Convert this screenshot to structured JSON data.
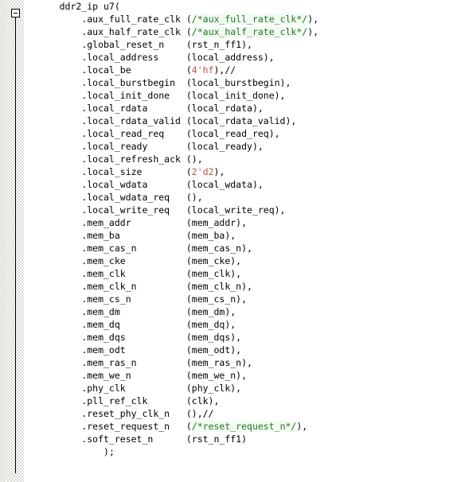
{
  "editor": {
    "gutter": {
      "fold_marker": "collapse-minus",
      "fold_state": "expanded"
    },
    "syntax_colors": {
      "default": "#000000",
      "comment": "#1a7a1a",
      "comment_background": "#f4faf4",
      "number_literal": "#c0504d",
      "background": "#ffffff",
      "gutter_background": "#e8e9e0"
    },
    "language": "verilog",
    "code_lines": [
      {
        "indent": 5,
        "tokens": [
          {
            "text": "ddr2_ip u7(",
            "type": "default"
          }
        ]
      },
      {
        "indent": 9,
        "tokens": [
          {
            "text": ".aux_full_rate_clk (",
            "type": "default"
          },
          {
            "text": "/*aux_full_rate_clk*/",
            "type": "comment"
          },
          {
            "text": "),",
            "type": "default"
          }
        ]
      },
      {
        "indent": 9,
        "tokens": [
          {
            "text": ".aux_half_rate_clk (",
            "type": "default"
          },
          {
            "text": "/*aux_half_rate_clk*/",
            "type": "comment"
          },
          {
            "text": "),",
            "type": "default"
          }
        ]
      },
      {
        "indent": 9,
        "tokens": [
          {
            "text": ".global_reset_n    (rst_n_ff1),",
            "type": "default"
          }
        ]
      },
      {
        "indent": 9,
        "tokens": [
          {
            "text": ".local_address     (local_address),",
            "type": "default"
          }
        ]
      },
      {
        "indent": 9,
        "tokens": [
          {
            "text": ".local_be          (",
            "type": "default"
          },
          {
            "text": "4'hf",
            "type": "number"
          },
          {
            "text": "),//",
            "type": "default"
          }
        ]
      },
      {
        "indent": 9,
        "tokens": [
          {
            "text": ".local_burstbegin  (local_burstbegin),",
            "type": "default"
          }
        ]
      },
      {
        "indent": 9,
        "tokens": [
          {
            "text": ".local_init_done   (local_init_done),",
            "type": "default"
          }
        ]
      },
      {
        "indent": 9,
        "tokens": [
          {
            "text": ".local_rdata       (local_rdata),",
            "type": "default"
          }
        ]
      },
      {
        "indent": 9,
        "tokens": [
          {
            "text": ".local_rdata_valid (local_rdata_valid),",
            "type": "default"
          }
        ]
      },
      {
        "indent": 9,
        "tokens": [
          {
            "text": ".local_read_req    (local_read_req),",
            "type": "default"
          }
        ]
      },
      {
        "indent": 9,
        "tokens": [
          {
            "text": ".local_ready       (local_ready),",
            "type": "default"
          }
        ]
      },
      {
        "indent": 9,
        "tokens": [
          {
            "text": ".local_refresh_ack (),",
            "type": "default"
          }
        ]
      },
      {
        "indent": 9,
        "tokens": [
          {
            "text": ".local_size        (",
            "type": "default"
          },
          {
            "text": "2'd2",
            "type": "number"
          },
          {
            "text": "),",
            "type": "default"
          }
        ]
      },
      {
        "indent": 9,
        "tokens": [
          {
            "text": ".local_wdata       (local_wdata),",
            "type": "default"
          }
        ]
      },
      {
        "indent": 9,
        "tokens": [
          {
            "text": ".local_wdata_req   (),",
            "type": "default"
          }
        ]
      },
      {
        "indent": 9,
        "tokens": [
          {
            "text": ".local_write_req   (local_write_req),",
            "type": "default"
          }
        ]
      },
      {
        "indent": 9,
        "tokens": [
          {
            "text": ".mem_addr          (mem_addr),",
            "type": "default"
          }
        ]
      },
      {
        "indent": 9,
        "tokens": [
          {
            "text": ".mem_ba            (mem_ba),",
            "type": "default"
          }
        ]
      },
      {
        "indent": 9,
        "tokens": [
          {
            "text": ".mem_cas_n         (mem_cas_n),",
            "type": "default"
          }
        ]
      },
      {
        "indent": 9,
        "tokens": [
          {
            "text": ".mem_cke           (mem_cke),",
            "type": "default"
          }
        ]
      },
      {
        "indent": 9,
        "tokens": [
          {
            "text": ".mem_clk           (mem_clk),",
            "type": "default"
          }
        ]
      },
      {
        "indent": 9,
        "tokens": [
          {
            "text": ".mem_clk_n         (mem_clk_n),",
            "type": "default"
          }
        ]
      },
      {
        "indent": 9,
        "tokens": [
          {
            "text": ".mem_cs_n          (mem_cs_n),",
            "type": "default"
          }
        ]
      },
      {
        "indent": 9,
        "tokens": [
          {
            "text": ".mem_dm            (mem_dm),",
            "type": "default"
          }
        ]
      },
      {
        "indent": 9,
        "tokens": [
          {
            "text": ".mem_dq            (mem_dq),",
            "type": "default"
          }
        ]
      },
      {
        "indent": 9,
        "tokens": [
          {
            "text": ".mem_dqs           (mem_dqs),",
            "type": "default"
          }
        ]
      },
      {
        "indent": 9,
        "tokens": [
          {
            "text": ".mem_odt           (mem_odt),",
            "type": "default"
          }
        ]
      },
      {
        "indent": 9,
        "tokens": [
          {
            "text": ".mem_ras_n         (mem_ras_n),",
            "type": "default"
          }
        ]
      },
      {
        "indent": 9,
        "tokens": [
          {
            "text": ".mem_we_n          (mem_we_n),",
            "type": "default"
          }
        ]
      },
      {
        "indent": 9,
        "tokens": [
          {
            "text": ".phy_clk           (phy_clk),",
            "type": "default"
          }
        ]
      },
      {
        "indent": 9,
        "tokens": [
          {
            "text": ".pll_ref_clk       (clk),",
            "type": "default"
          }
        ]
      },
      {
        "indent": 9,
        "tokens": [
          {
            "text": ".reset_phy_clk_n   (),//",
            "type": "default"
          }
        ]
      },
      {
        "indent": 9,
        "tokens": [
          {
            "text": ".reset_request_n   (",
            "type": "default"
          },
          {
            "text": "/*reset_request_n*/",
            "type": "comment"
          },
          {
            "text": "),",
            "type": "default"
          }
        ]
      },
      {
        "indent": 9,
        "tokens": [
          {
            "text": ".soft_reset_n      (rst_n_ff1)",
            "type": "default"
          }
        ]
      },
      {
        "indent": 13,
        "tokens": [
          {
            "text": ");",
            "type": "default"
          }
        ]
      }
    ]
  }
}
